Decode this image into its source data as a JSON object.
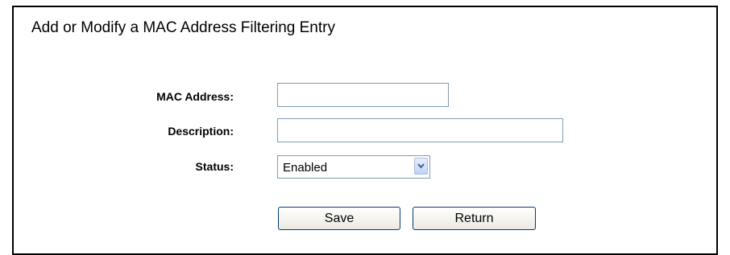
{
  "form": {
    "title": "Add or Modify a MAC Address Filtering Entry",
    "mac_label": "MAC Address:",
    "mac_value": "",
    "description_label": "Description:",
    "description_value": "",
    "status_label": "Status:",
    "status_value": "Enabled",
    "status_arrow_icon": "chevron-down-icon"
  },
  "buttons": {
    "save_label": "Save",
    "return_label": "Return"
  },
  "colors": {
    "border": "#000000",
    "input_border": "#7f9db9",
    "button_border": "#003c74",
    "arrow_color": "#4d6185"
  }
}
